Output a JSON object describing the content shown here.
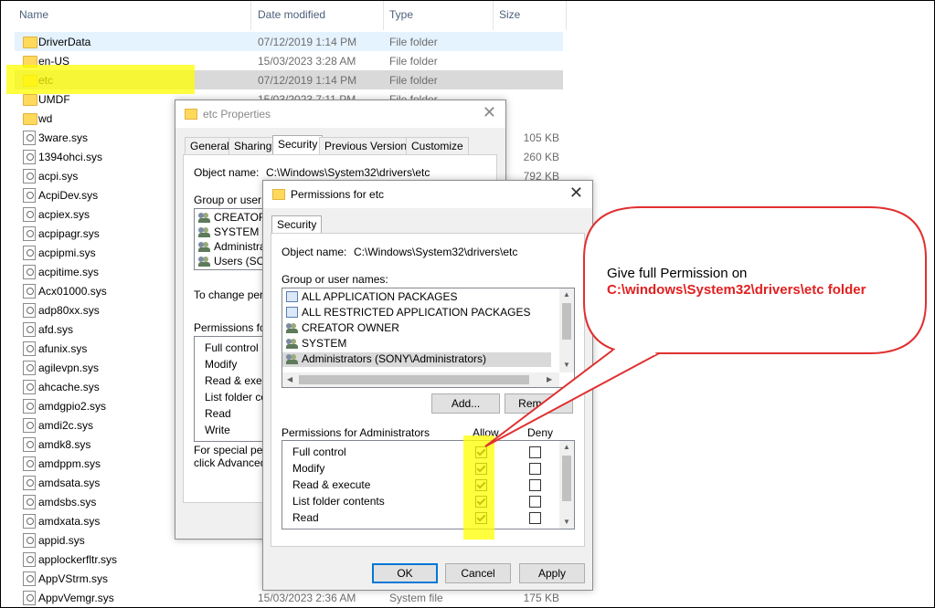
{
  "explorer": {
    "columns": {
      "name": "Name",
      "date": "Date modified",
      "type": "Type",
      "size": "Size"
    },
    "rows": [
      {
        "name": "DriverData",
        "date": "07/12/2019 1:14 PM",
        "type": "File folder",
        "size": "",
        "kind": "folder",
        "state": "sel"
      },
      {
        "name": "en-US",
        "date": "15/03/2023 3:28 AM",
        "type": "File folder",
        "size": "",
        "kind": "folder",
        "state": ""
      },
      {
        "name": "etc",
        "date": "07/12/2019 1:14 PM",
        "type": "File folder",
        "size": "",
        "kind": "folder",
        "state": "gray"
      },
      {
        "name": "UMDF",
        "date": "15/03/2023 7:11 PM",
        "type": "File folder",
        "size": "",
        "kind": "folder",
        "state": ""
      },
      {
        "name": "wd",
        "date": "",
        "type": "",
        "size": "",
        "kind": "folder",
        "state": ""
      },
      {
        "name": "3ware.sys",
        "date": "",
        "type": "",
        "size": "105 KB",
        "kind": "sys",
        "state": ""
      },
      {
        "name": "1394ohci.sys",
        "date": "",
        "type": "",
        "size": "260 KB",
        "kind": "sys",
        "state": ""
      },
      {
        "name": "acpi.sys",
        "date": "",
        "type": "",
        "size": "792 KB",
        "kind": "sys",
        "state": ""
      },
      {
        "name": "AcpiDev.sys",
        "date": "",
        "type": "",
        "size": "",
        "kind": "sys",
        "state": ""
      },
      {
        "name": "acpiex.sys",
        "date": "",
        "type": "",
        "size": "",
        "kind": "sys",
        "state": ""
      },
      {
        "name": "acpipagr.sys",
        "date": "",
        "type": "",
        "size": "",
        "kind": "sys",
        "state": ""
      },
      {
        "name": "acpipmi.sys",
        "date": "",
        "type": "",
        "size": "",
        "kind": "sys",
        "state": ""
      },
      {
        "name": "acpitime.sys",
        "date": "",
        "type": "",
        "size": "",
        "kind": "sys",
        "state": ""
      },
      {
        "name": "Acx01000.sys",
        "date": "",
        "type": "",
        "size": "",
        "kind": "sys",
        "state": ""
      },
      {
        "name": "adp80xx.sys",
        "date": "",
        "type": "",
        "size": "",
        "kind": "sys",
        "state": ""
      },
      {
        "name": "afd.sys",
        "date": "",
        "type": "",
        "size": "",
        "kind": "sys",
        "state": ""
      },
      {
        "name": "afunix.sys",
        "date": "",
        "type": "",
        "size": "",
        "kind": "sys",
        "state": ""
      },
      {
        "name": "agilevpn.sys",
        "date": "",
        "type": "",
        "size": "",
        "kind": "sys",
        "state": ""
      },
      {
        "name": "ahcache.sys",
        "date": "",
        "type": "",
        "size": "",
        "kind": "sys",
        "state": ""
      },
      {
        "name": "amdgpio2.sys",
        "date": "",
        "type": "",
        "size": "",
        "kind": "sys",
        "state": ""
      },
      {
        "name": "amdi2c.sys",
        "date": "",
        "type": "",
        "size": "",
        "kind": "sys",
        "state": ""
      },
      {
        "name": "amdk8.sys",
        "date": "",
        "type": "",
        "size": "",
        "kind": "sys",
        "state": ""
      },
      {
        "name": "amdppm.sys",
        "date": "",
        "type": "",
        "size": "",
        "kind": "sys",
        "state": ""
      },
      {
        "name": "amdsata.sys",
        "date": "",
        "type": "",
        "size": "",
        "kind": "sys",
        "state": ""
      },
      {
        "name": "amdsbs.sys",
        "date": "",
        "type": "",
        "size": "",
        "kind": "sys",
        "state": ""
      },
      {
        "name": "amdxata.sys",
        "date": "",
        "type": "",
        "size": "",
        "kind": "sys",
        "state": ""
      },
      {
        "name": "appid.sys",
        "date": "",
        "type": "",
        "size": "",
        "kind": "sys",
        "state": ""
      },
      {
        "name": "applockerfltr.sys",
        "date": "",
        "type": "",
        "size": "",
        "kind": "sys",
        "state": ""
      },
      {
        "name": "AppVStrm.sys",
        "date": "",
        "type": "",
        "size": "",
        "kind": "sys",
        "state": ""
      },
      {
        "name": "AppvVemgr.sys",
        "date": "15/03/2023 2:36 AM",
        "type": "System file",
        "size": "175 KB",
        "kind": "sys",
        "state": ""
      }
    ]
  },
  "props": {
    "title": "etc Properties",
    "tabs": [
      "General",
      "Sharing",
      "Security",
      "Previous Versions",
      "Customize"
    ],
    "object_label": "Object name:",
    "object_value": "C:\\Windows\\System32\\drivers\\etc",
    "group_label": "Group or user na",
    "users": [
      "CREATOR",
      "SYSTEM",
      "Administrat",
      "Users (SON"
    ],
    "change_text": "To change perm",
    "perm_label": "Permissions for",
    "perms": [
      "Full control",
      "Modify",
      "Read & execu",
      "List folder co",
      "Read",
      "Write"
    ],
    "special1": "For special perm",
    "special2": "click Advanced"
  },
  "perm": {
    "title": "Permissions for etc",
    "close": "✕",
    "tab": "Security",
    "object_label": "Object name:",
    "object_value": "C:\\Windows\\System32\\drivers\\etc",
    "group_label": "Group or user names:",
    "users": [
      {
        "name": "ALL APPLICATION PACKAGES",
        "icon": "pkg"
      },
      {
        "name": "ALL RESTRICTED APPLICATION PACKAGES",
        "icon": "pkg"
      },
      {
        "name": "CREATOR OWNER",
        "icon": "people"
      },
      {
        "name": "SYSTEM",
        "icon": "people"
      },
      {
        "name": "Administrators (SONY\\Administrators)",
        "icon": "people"
      }
    ],
    "add_label": "Add...",
    "remove_label": "Remove",
    "perm_header": "Permissions for Administrators",
    "allow": "Allow",
    "deny": "Deny",
    "perms": [
      {
        "name": "Full control",
        "allow": true,
        "deny": false
      },
      {
        "name": "Modify",
        "allow": true,
        "deny": false
      },
      {
        "name": "Read & execute",
        "allow": true,
        "deny": false
      },
      {
        "name": "List folder contents",
        "allow": true,
        "deny": false
      },
      {
        "name": "Read",
        "allow": true,
        "deny": false
      }
    ],
    "ok": "OK",
    "cancel": "Cancel",
    "apply": "Apply"
  },
  "callout": {
    "line1": "Give full Permission on",
    "line2": "C:\\windows\\System32\\drivers\\etc folder",
    "text_color": "#e02020",
    "border_color": "#e03030"
  }
}
